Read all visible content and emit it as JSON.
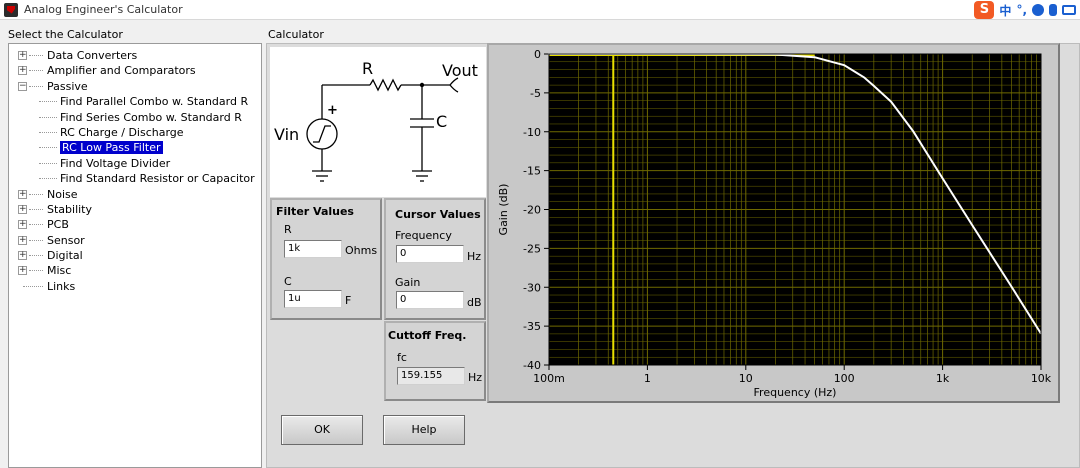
{
  "window": {
    "title": "Analog Engineer's Calculator"
  },
  "ime": {
    "lang": "中",
    "punct": "°,"
  },
  "left": {
    "label": "Select the Calculator",
    "tree": [
      {
        "label": "Data Converters",
        "level": 0,
        "expander": "+"
      },
      {
        "label": "Amplifier and Comparators",
        "level": 0,
        "expander": "+"
      },
      {
        "label": "Passive",
        "level": 0,
        "expander": "−"
      },
      {
        "label": "Find Parallel Combo w. Standard R",
        "level": 1
      },
      {
        "label": "Find Series Combo w. Standard R",
        "level": 1
      },
      {
        "label": "RC Charge / Discharge",
        "level": 1
      },
      {
        "label": "RC Low Pass Filter",
        "level": 1,
        "selected": true
      },
      {
        "label": "Find Voltage Divider",
        "level": 1
      },
      {
        "label": "Find Standard Resistor or Capacitor",
        "level": 1
      },
      {
        "label": "Noise",
        "level": 0,
        "expander": "+"
      },
      {
        "label": "Stability",
        "level": 0,
        "expander": "+"
      },
      {
        "label": "PCB",
        "level": 0,
        "expander": "+"
      },
      {
        "label": "Sensor",
        "level": 0,
        "expander": "+"
      },
      {
        "label": "Digital",
        "level": 0,
        "expander": "+"
      },
      {
        "label": "Misc",
        "level": 0,
        "expander": "+"
      },
      {
        "label": "Links",
        "level": 0
      }
    ]
  },
  "calculator": {
    "label": "Calculator",
    "schematic": {
      "r": "R",
      "vout": "Vout",
      "c": "C",
      "vin": "Vin",
      "plus": "+"
    },
    "filter_values": {
      "title": "Filter Values",
      "r_label": "R",
      "r_value": "1k",
      "r_unit": "Ohms",
      "c_label": "C",
      "c_value": "1u",
      "c_unit": "F"
    },
    "cursor_values": {
      "title": "Cursor Values",
      "freq_label": "Frequency",
      "freq_value": "0",
      "freq_unit": "Hz",
      "gain_label": "Gain",
      "gain_value": "0",
      "gain_unit": "dB"
    },
    "cutoff": {
      "title": "Cuttoff Freq.",
      "label": "fc",
      "value": "159.155",
      "unit": "Hz"
    },
    "buttons": {
      "ok": "OK",
      "help": "Help"
    }
  },
  "chart_data": {
    "type": "line",
    "xlabel": "Frequency (Hz)",
    "ylabel": "Gain (dB)",
    "x_scale": "log",
    "xlim": [
      0.1,
      10000
    ],
    "ylim": [
      -40,
      0
    ],
    "x_ticks": [
      {
        "value": 0.1,
        "label": "100m"
      },
      {
        "value": 1,
        "label": "1"
      },
      {
        "value": 10,
        "label": "10"
      },
      {
        "value": 100,
        "label": "100"
      },
      {
        "value": 1000,
        "label": "1k"
      },
      {
        "value": 10000,
        "label": "10k"
      }
    ],
    "y_ticks": [
      0,
      -5,
      -10,
      -15,
      -20,
      -25,
      -30,
      -35,
      -40
    ],
    "grid": true,
    "cursor_x": 0.45,
    "colors": {
      "plot_bg": "#000000",
      "grid": "#6f6a00",
      "cursor": "#e8e000",
      "curve": "#ffffff"
    },
    "series": [
      {
        "x": [
          0.1,
          1,
          10,
          20,
          50,
          100,
          159.155,
          200,
          300,
          500,
          1000,
          2000,
          5000,
          10000
        ],
        "y": [
          0,
          0,
          -0.02,
          -0.07,
          -0.41,
          -1.44,
          -3.01,
          -4.1,
          -6.13,
          -9.9,
          -16.0,
          -22.0,
          -29.9,
          -35.96
        ]
      }
    ]
  }
}
